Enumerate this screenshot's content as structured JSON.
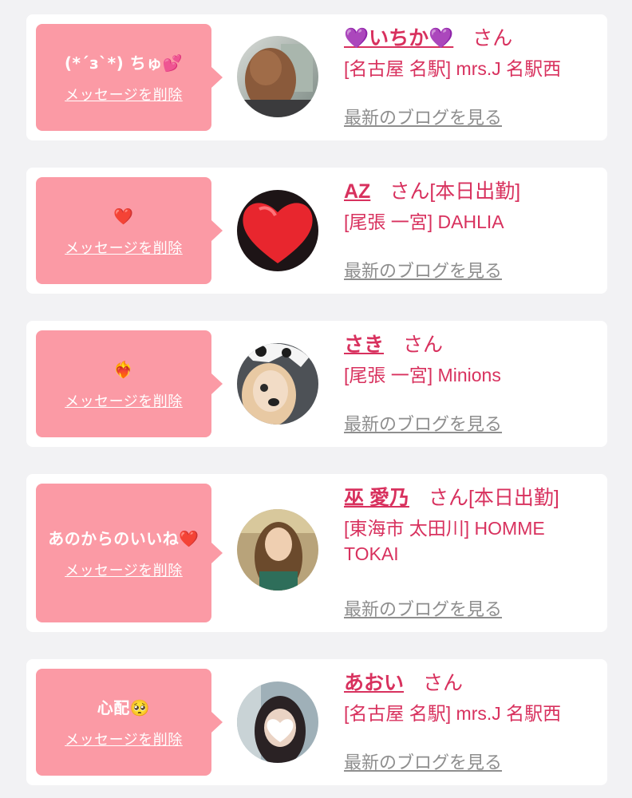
{
  "colors": {
    "bubble_bg": "#fb9aa5",
    "accent_text": "#d8315e",
    "blog_link": "#8e8e8e",
    "page_bg": "#f2f2f4"
  },
  "messages": [
    {
      "message": "(*´з`*) ちゅ💕",
      "delete_label": "メッセージを削除",
      "girl_name": "💜いちか💜",
      "honorific": "さん",
      "status": "",
      "shop": "[名古屋 名駅] mrs.J 名駅西",
      "blog_label": "最新のブログを見る",
      "avatar_icon": "avatar-photo-icon"
    },
    {
      "message": "❤️",
      "delete_label": "メッセージを削除",
      "girl_name": "AZ",
      "honorific": "さん",
      "status": "[本日出勤]",
      "shop": "[尾張 一宮] DAHLIA",
      "blog_label": "最新のブログを見る",
      "avatar_icon": "avatar-photo-icon"
    },
    {
      "message": "❤️‍🔥",
      "delete_label": "メッセージを削除",
      "girl_name": "さき",
      "honorific": "さん",
      "status": "",
      "shop": "[尾張 一宮] Minions",
      "blog_label": "最新のブログを見る",
      "avatar_icon": "avatar-photo-icon"
    },
    {
      "message": "あのからのいいね❤️",
      "delete_label": "メッセージを削除",
      "girl_name": "巫 愛乃",
      "honorific": "さん",
      "status": "[本日出勤]",
      "shop": "[東海市 太田川] HOMME TOKAI",
      "blog_label": "最新のブログを見る",
      "avatar_icon": "avatar-photo-icon"
    },
    {
      "message": "心配🥺",
      "delete_label": "メッセージを削除",
      "girl_name": "あおい",
      "honorific": "さん",
      "status": "",
      "shop": "[名古屋 名駅] mrs.J 名駅西",
      "blog_label": "最新のブログを見る",
      "avatar_icon": "avatar-photo-icon"
    }
  ]
}
